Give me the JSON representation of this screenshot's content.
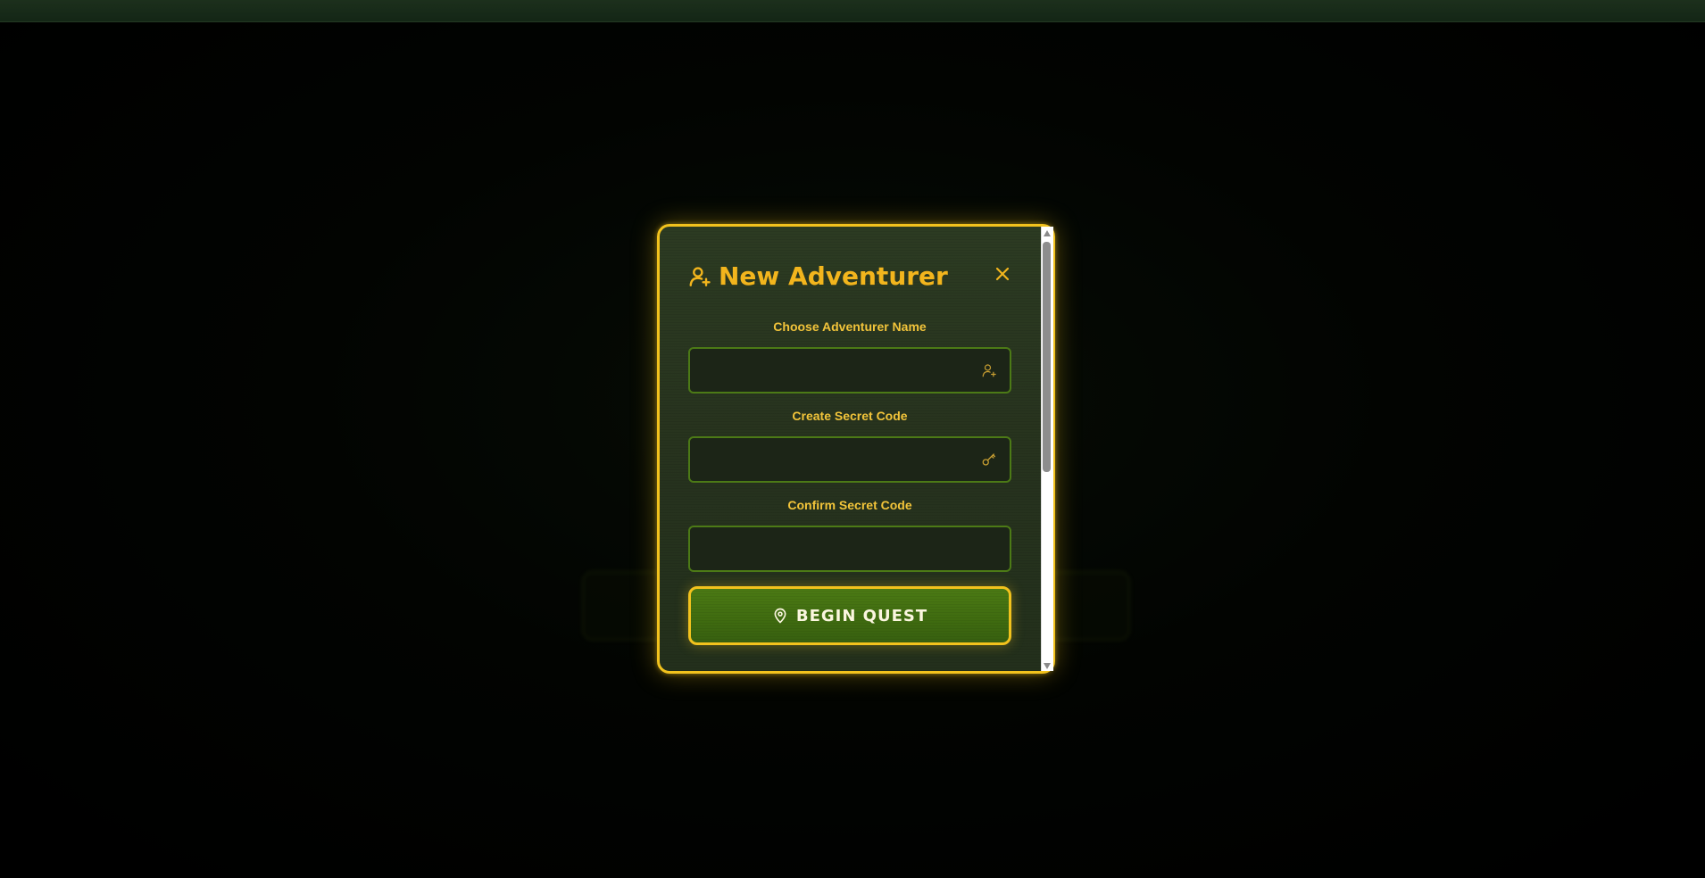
{
  "modal": {
    "title": "New Adventurer",
    "title_icon": "user-plus-icon",
    "close_icon": "close-icon",
    "fields": [
      {
        "label": "Choose Adventurer Name",
        "value": "",
        "icon": "user-plus-icon"
      },
      {
        "label": "Create Secret Code",
        "value": "",
        "icon": "key-icon"
      },
      {
        "label": "Confirm Secret Code",
        "value": "",
        "icon": ""
      }
    ],
    "submit": {
      "label": "BEGIN QUEST",
      "icon": "map-pin-icon"
    }
  },
  "colors": {
    "accent_gold": "#f2c21d",
    "title_gold": "#f2b51d",
    "button_green": "#4b7a14",
    "field_border": "#4c7a16"
  }
}
